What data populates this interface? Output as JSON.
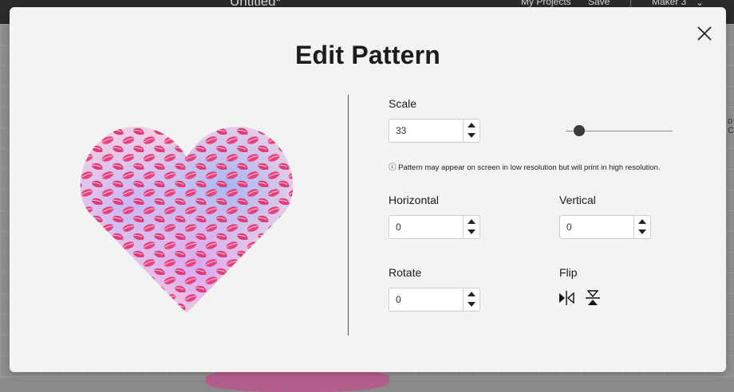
{
  "app": {
    "doc_title": "Untitled*",
    "my_projects": "My Projects",
    "save": "Save",
    "machine": "Maker 3",
    "side_text": "o C"
  },
  "dialog": {
    "title": "Edit Pattern",
    "scale": {
      "label": "Scale",
      "value": "33",
      "slider_fraction": 0.08
    },
    "note": "ⓘ Pattern may appear on screen in low resolution but will print in high resolution.",
    "horizontal": {
      "label": "Horizontal",
      "value": "0"
    },
    "vertical": {
      "label": "Vertical",
      "value": "0"
    },
    "rotate": {
      "label": "Rotate",
      "value": "0"
    },
    "flip": {
      "label": "Flip",
      "horizontal_icon": "flip-horizontal-icon",
      "vertical_icon": "flip-vertical-icon"
    },
    "preview": {
      "shape": "heart",
      "pattern": "pink lips on holographic background"
    }
  },
  "colors": {
    "modal_bg": "#f3f3f3",
    "lips": "#e8417e",
    "holo_pink": "#f7c9dc",
    "holo_violet": "#b9a6ef"
  }
}
